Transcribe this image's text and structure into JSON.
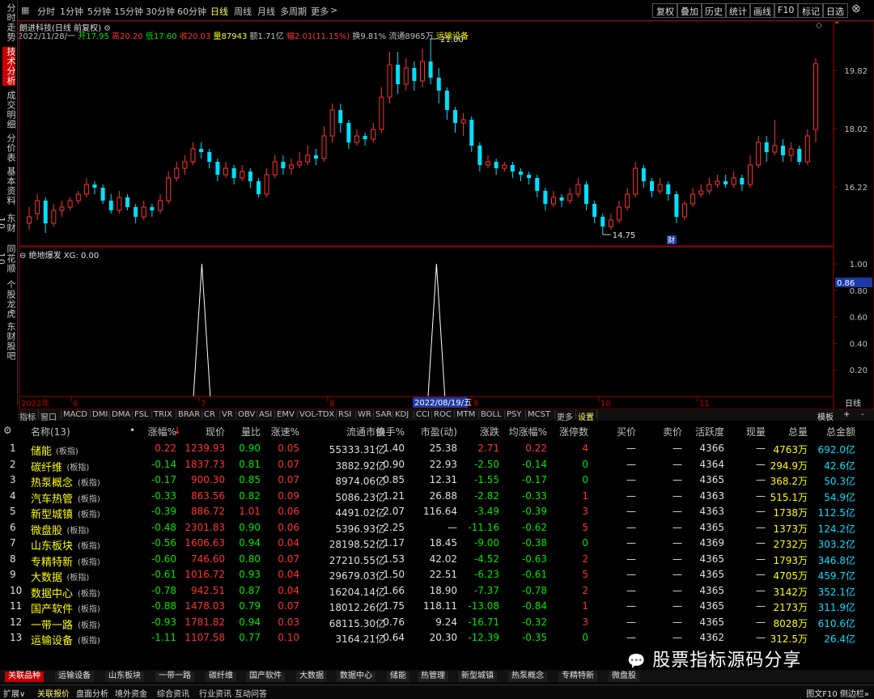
{
  "sidebar": {
    "tabs": [
      "分时走势",
      "技术分析",
      "成交明细",
      "分价表",
      "基本资料",
      "东财10",
      "同花顺10",
      "个股龙虎",
      "东财股吧"
    ],
    "active": 1
  },
  "topbar": {
    "periods": [
      "分时",
      "1分钟",
      "5分钟",
      "15分钟",
      "30分钟",
      "60分钟",
      "日线",
      "周线",
      "月线",
      "多周期",
      "更多"
    ],
    "active": 6,
    "right": [
      "复权",
      "叠加",
      "历史",
      "统计",
      "画线",
      "F10",
      "标记",
      "日选"
    ]
  },
  "stock": {
    "title": "朗进科技(日线 前复权)",
    "date": "2022/11/28/一",
    "open_label": "开",
    "open": "17.95",
    "high_label": "高",
    "high": "20.20",
    "low_label": "低",
    "low": "17.60",
    "close_label": "收",
    "close": "20.03",
    "vol_label": "量",
    "volume": "87943",
    "amt_label": "额",
    "amount": "1.71亿",
    "chg_label": "幅",
    "change": "2.01(11.15%)",
    "turn_label": "换",
    "turnover": "9.81%",
    "float_label": "流通",
    "float": "8965万",
    "sector": "运输设备"
  },
  "chart_data": [
    {
      "type": "candlestick",
      "title": "",
      "y_ticks": [
        "19.82",
        "18.02",
        "16.22"
      ],
      "ylim": [
        14.5,
        20.7
      ],
      "max_label": "21.00",
      "min_label": "14.75",
      "fin_marker": "财",
      "ohlc": [
        [
          15.1,
          15.3,
          15.6,
          14.9
        ],
        [
          15.4,
          15.8,
          16.0,
          15.2
        ],
        [
          15.8,
          15.1,
          15.9,
          14.8
        ],
        [
          15.1,
          15.5,
          15.7,
          15.0
        ],
        [
          15.5,
          15.6,
          15.8,
          15.3
        ],
        [
          15.6,
          15.8,
          15.9,
          15.5
        ],
        [
          15.8,
          16.0,
          16.1,
          15.7
        ],
        [
          16.0,
          16.3,
          16.5,
          15.9
        ],
        [
          16.3,
          16.2,
          16.4,
          16.0
        ],
        [
          16.2,
          15.8,
          16.3,
          15.7
        ],
        [
          15.8,
          15.5,
          16.0,
          15.4
        ],
        [
          15.5,
          15.9,
          16.1,
          15.4
        ],
        [
          15.9,
          15.6,
          16.0,
          15.5
        ],
        [
          15.6,
          15.3,
          15.7,
          15.1
        ],
        [
          15.3,
          15.6,
          15.8,
          15.2
        ],
        [
          15.6,
          15.5,
          15.7,
          15.3
        ],
        [
          15.5,
          15.8,
          16.0,
          15.4
        ],
        [
          15.8,
          16.5,
          16.7,
          15.7
        ],
        [
          16.5,
          16.8,
          17.0,
          16.4
        ],
        [
          16.8,
          17.0,
          17.2,
          16.6
        ],
        [
          17.0,
          17.4,
          17.6,
          16.9
        ],
        [
          17.4,
          17.3,
          17.6,
          17.1
        ],
        [
          17.3,
          17.0,
          17.4,
          16.8
        ],
        [
          17.0,
          16.6,
          17.1,
          16.4
        ],
        [
          16.6,
          16.8,
          17.0,
          16.5
        ],
        [
          16.8,
          16.5,
          16.9,
          16.3
        ],
        [
          16.5,
          16.7,
          16.9,
          16.4
        ],
        [
          16.7,
          16.4,
          16.8,
          16.2
        ],
        [
          16.4,
          16.0,
          16.5,
          15.9
        ],
        [
          16.0,
          16.6,
          16.8,
          15.9
        ],
        [
          16.6,
          17.0,
          17.2,
          16.5
        ],
        [
          17.0,
          16.8,
          17.2,
          16.6
        ],
        [
          16.8,
          16.9,
          17.1,
          16.6
        ],
        [
          16.9,
          17.0,
          17.3,
          16.8
        ],
        [
          17.0,
          17.2,
          17.5,
          16.9
        ],
        [
          17.2,
          17.1,
          17.4,
          16.9
        ],
        [
          17.1,
          17.8,
          18.1,
          17.0
        ],
        [
          17.8,
          18.6,
          18.8,
          17.6
        ],
        [
          18.6,
          18.2,
          18.8,
          17.9
        ],
        [
          18.2,
          17.6,
          18.3,
          17.4
        ],
        [
          17.6,
          17.8,
          18.0,
          17.5
        ],
        [
          17.8,
          17.7,
          17.9,
          17.5
        ],
        [
          17.7,
          18.0,
          18.2,
          17.6
        ],
        [
          18.0,
          19.0,
          19.3,
          17.9
        ],
        [
          19.0,
          20.0,
          20.4,
          18.8
        ],
        [
          20.0,
          19.4,
          20.4,
          19.1
        ],
        [
          19.4,
          19.9,
          20.2,
          19.2
        ],
        [
          19.9,
          19.5,
          20.1,
          19.2
        ],
        [
          19.5,
          20.1,
          20.5,
          19.3
        ],
        [
          20.1,
          19.6,
          20.8,
          19.4
        ],
        [
          19.6,
          19.2,
          19.9,
          18.8
        ],
        [
          19.2,
          18.6,
          19.3,
          18.3
        ],
        [
          18.6,
          18.2,
          18.7,
          17.9
        ],
        [
          18.2,
          18.3,
          18.5,
          17.8
        ],
        [
          18.3,
          17.5,
          18.4,
          17.3
        ],
        [
          17.5,
          16.9,
          17.6,
          16.7
        ],
        [
          16.9,
          17.0,
          17.2,
          16.8
        ],
        [
          17.0,
          16.8,
          17.1,
          16.6
        ],
        [
          16.8,
          16.9,
          17.0,
          16.7
        ],
        [
          16.9,
          16.7,
          17.0,
          16.5
        ],
        [
          16.7,
          16.6,
          16.8,
          16.4
        ],
        [
          16.6,
          16.5,
          16.7,
          16.3
        ],
        [
          16.5,
          16.1,
          16.6,
          15.9
        ],
        [
          16.1,
          15.7,
          16.2,
          15.5
        ],
        [
          15.7,
          15.9,
          16.1,
          15.6
        ],
        [
          15.9,
          15.8,
          16.0,
          15.6
        ],
        [
          15.8,
          16.0,
          16.2,
          15.7
        ],
        [
          16.0,
          16.3,
          16.5,
          15.9
        ],
        [
          16.3,
          15.7,
          16.4,
          15.5
        ],
        [
          15.7,
          15.3,
          15.8,
          15.1
        ],
        [
          15.3,
          15.0,
          15.4,
          14.75
        ],
        [
          15.0,
          15.2,
          15.4,
          14.9
        ],
        [
          15.2,
          15.6,
          15.8,
          15.1
        ],
        [
          15.6,
          16.0,
          16.2,
          15.5
        ],
        [
          16.0,
          16.8,
          17.0,
          15.9
        ],
        [
          16.8,
          16.4,
          16.9,
          16.2
        ],
        [
          16.4,
          16.1,
          16.5,
          15.9
        ],
        [
          16.1,
          16.3,
          16.5,
          16.0
        ],
        [
          16.3,
          16.0,
          16.4,
          15.8
        ],
        [
          16.0,
          15.3,
          16.1,
          15.1
        ],
        [
          15.3,
          15.7,
          15.8,
          15.2
        ],
        [
          15.7,
          16.0,
          16.2,
          15.6
        ],
        [
          16.0,
          16.1,
          16.3,
          15.9
        ],
        [
          16.1,
          16.3,
          16.5,
          16.0
        ],
        [
          16.3,
          16.4,
          16.6,
          16.2
        ],
        [
          16.4,
          16.3,
          16.6,
          16.2
        ],
        [
          16.3,
          16.5,
          16.7,
          16.2
        ],
        [
          16.5,
          16.3,
          16.6,
          16.1
        ],
        [
          16.3,
          16.9,
          17.2,
          16.2
        ],
        [
          16.9,
          17.6,
          17.8,
          16.8
        ],
        [
          17.6,
          17.3,
          17.8,
          17.0
        ],
        [
          17.3,
          17.5,
          18.3,
          17.2
        ],
        [
          17.5,
          17.2,
          17.7,
          17.0
        ],
        [
          17.2,
          17.4,
          17.6,
          17.0
        ],
        [
          17.4,
          17.0,
          17.5,
          16.9
        ],
        [
          17.0,
          17.8,
          18.0,
          16.9
        ],
        [
          18.0,
          20.03,
          20.2,
          17.6
        ]
      ]
    },
    {
      "type": "line",
      "title": "绝地爆发",
      "series": [
        {
          "name": "XG",
          "current": "0.00"
        }
      ],
      "y_ticks": [
        "1.00",
        "0.80",
        "0.60",
        "0.40",
        "0.20"
      ],
      "cursor_value": "0.86",
      "ylim": [
        0,
        1.05
      ],
      "values": [
        0,
        0,
        0,
        0,
        0,
        0,
        0,
        0,
        0,
        0,
        0,
        0,
        0,
        0,
        0,
        0,
        0,
        0,
        0,
        0,
        0,
        1,
        0,
        0,
        0,
        0,
        0,
        0,
        0,
        0,
        0,
        0,
        0,
        0,
        0,
        0,
        0,
        0,
        0,
        0,
        0,
        0,
        0,
        0,
        0,
        0,
        0,
        0,
        0,
        1,
        0,
        0,
        0,
        0,
        0,
        0,
        0,
        0,
        0,
        0,
        0,
        0,
        0,
        0,
        0,
        0,
        0,
        0,
        0,
        0,
        0,
        0,
        0,
        0,
        0,
        0,
        0,
        0,
        0,
        0,
        0,
        0,
        0,
        0,
        0,
        0,
        0,
        0,
        0,
        0,
        0,
        0,
        0,
        0,
        0,
        0,
        0
      ]
    }
  ],
  "timeline": {
    "labels": [
      "2022年",
      "6",
      "7",
      "8",
      "9",
      "10",
      "11"
    ],
    "highlight": "2022/08/19/五",
    "right_label": "日线"
  },
  "indicator_tabs": [
    "指标",
    "窗口",
    "MACD",
    "DMI",
    "DMA",
    "FSL",
    "TRIX",
    "BRAR",
    "CR",
    "VR",
    "OBV",
    "ASI",
    "EMV",
    "VOL-TDX",
    "RSI",
    "WR",
    "SAR",
    "KDJ",
    "CCI",
    "ROC",
    "MTM",
    "BOLL",
    "PSY",
    "MCST",
    "更多",
    "设置"
  ],
  "indicator_right": [
    "模板",
    "+",
    "-"
  ],
  "table": {
    "headers": [
      "名称(13)",
      "涨幅%",
      "现价",
      "量比",
      "涨速%",
      "流通市值",
      "换手%",
      "市盈(动)",
      "涨跌",
      "均涨幅%",
      "涨停数",
      "买价",
      "卖价",
      "活跃度",
      "现量",
      "总量",
      "总金额"
    ],
    "rows": [
      [
        "1",
        "储能",
        "(板指)",
        "0.22",
        "1239.93",
        "0.90",
        "0.05",
        "55333.31亿",
        "1.40",
        "25.38",
        "2.71",
        "0.22",
        "4",
        "—",
        "—",
        "4366",
        "—",
        "4763万",
        "692.0亿"
      ],
      [
        "2",
        "碳纤维",
        "(板指)",
        "-0.14",
        "1837.73",
        "0.81",
        "0.07",
        "3882.92亿",
        "0.90",
        "22.93",
        "-2.50",
        "-0.14",
        "0",
        "—",
        "—",
        "4364",
        "—",
        "294.9万",
        "42.6亿"
      ],
      [
        "3",
        "热泵概念",
        "(板指)",
        "-0.17",
        "900.30",
        "0.85",
        "0.07",
        "8974.06亿",
        "0.85",
        "12.31",
        "-1.55",
        "-0.17",
        "0",
        "—",
        "—",
        "4365",
        "—",
        "368.2万",
        "50.3亿"
      ],
      [
        "4",
        "汽车热管",
        "(板指)",
        "-0.33",
        "863.56",
        "0.82",
        "0.09",
        "5086.23亿",
        "1.21",
        "26.88",
        "-2.82",
        "-0.33",
        "1",
        "—",
        "—",
        "4363",
        "—",
        "515.1万",
        "54.9亿"
      ],
      [
        "5",
        "新型城镇",
        "(板指)",
        "-0.39",
        "886.72",
        "1.01",
        "0.06",
        "4491.02亿",
        "2.07",
        "116.64",
        "-3.49",
        "-0.39",
        "3",
        "—",
        "—",
        "4363",
        "—",
        "1738万",
        "112.5亿"
      ],
      [
        "6",
        "微盘股",
        "(板指)",
        "-0.48",
        "2301.83",
        "0.90",
        "0.06",
        "5396.93亿",
        "2.25",
        "—",
        "-11.16",
        "-0.62",
        "5",
        "—",
        "—",
        "4365",
        "—",
        "1373万",
        "124.2亿"
      ],
      [
        "7",
        "山东板块",
        "(板指)",
        "-0.56",
        "1606.63",
        "0.94",
        "0.04",
        "28198.52亿",
        "1.17",
        "18.45",
        "-9.00",
        "-0.38",
        "0",
        "—",
        "—",
        "4369",
        "—",
        "2732万",
        "303.2亿"
      ],
      [
        "8",
        "专精特新",
        "(板指)",
        "-0.60",
        "746.60",
        "0.80",
        "0.07",
        "27210.55亿",
        "1.53",
        "42.02",
        "-4.52",
        "-0.63",
        "2",
        "—",
        "—",
        "4365",
        "—",
        "1793万",
        "346.8亿"
      ],
      [
        "9",
        "大数据",
        "(板指)",
        "-0.61",
        "1016.72",
        "0.93",
        "0.04",
        "29679.03亿",
        "1.50",
        "22.51",
        "-6.23",
        "-0.61",
        "5",
        "—",
        "—",
        "4365",
        "—",
        "4705万",
        "459.7亿"
      ],
      [
        "10",
        "数据中心",
        "(板指)",
        "-0.78",
        "942.51",
        "0.87",
        "0.04",
        "16204.14亿",
        "1.66",
        "18.90",
        "-7.37",
        "-0.78",
        "2",
        "—",
        "—",
        "4365",
        "—",
        "3142万",
        "352.1亿"
      ],
      [
        "11",
        "国产软件",
        "(板指)",
        "-0.88",
        "1478.03",
        "0.79",
        "0.07",
        "18012.26亿",
        "1.75",
        "118.11",
        "-13.08",
        "-0.84",
        "1",
        "—",
        "—",
        "4365",
        "—",
        "2173万",
        "311.9亿"
      ],
      [
        "12",
        "一带一路",
        "(板指)",
        "-0.93",
        "1781.82",
        "0.94",
        "0.03",
        "68115.30亿",
        "0.76",
        "9.24",
        "-16.71",
        "-0.32",
        "3",
        "—",
        "—",
        "4365",
        "—",
        "8028万",
        "610.6亿"
      ],
      [
        "13",
        "运输设备",
        "(板指)",
        "-1.11",
        "1107.58",
        "0.77",
        "0.10",
        "3164.21亿",
        "0.64",
        "20.30",
        "-12.39",
        "-0.35",
        "0",
        "—",
        "—",
        "4362",
        "—",
        "312.5万",
        "26.4亿"
      ]
    ]
  },
  "bottom_tabs": [
    "关联品种",
    "运输设备",
    "山东板块",
    "一带一路",
    "碳纤维",
    "国产软件",
    "大数据",
    "数据中心",
    "储能",
    "热管理",
    "新型城镇",
    "热泵概念",
    "专精特新",
    "微盘股"
  ],
  "status_items": [
    "扩展∨",
    "关联报价",
    "盘面分析",
    "境外资金",
    "综合资讯",
    "行业资讯",
    "互动问答"
  ],
  "status_right": "图文F10 侧边栏»",
  "watermark": "股票指标源码分享",
  "colors": {
    "up": "#ff3232",
    "down": "#00e0ff",
    "accent": "#c00000",
    "indicator_line": "#ffffff"
  }
}
